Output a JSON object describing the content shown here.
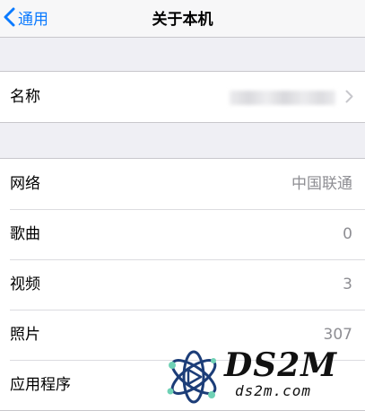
{
  "nav": {
    "back_label": "通用",
    "title": "关于本机"
  },
  "name_row": {
    "label": "名称"
  },
  "rows": [
    {
      "label": "网络",
      "value": "中国联通"
    },
    {
      "label": "歌曲",
      "value": "0"
    },
    {
      "label": "视频",
      "value": "3"
    },
    {
      "label": "照片",
      "value": "307"
    },
    {
      "label": "应用程序",
      "value": ""
    }
  ],
  "watermark": {
    "logo": "DS2M",
    "site": "ds2m.com"
  },
  "colors": {
    "accent": "#0a7aff",
    "background": "#efeff4",
    "value_text": "#8e8e93"
  },
  "icons": [
    "chevron-left-icon",
    "chevron-right-icon",
    "atom-logo-icon"
  ]
}
